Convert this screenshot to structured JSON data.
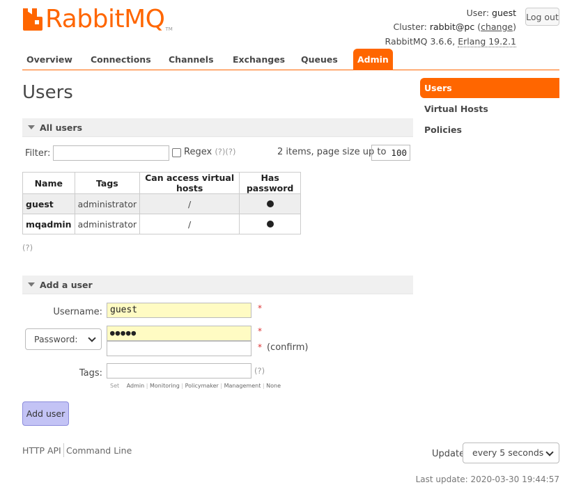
{
  "brand": {
    "logo_text": "RabbitMQ",
    "logo_tm": "TM",
    "accent": "#ff6600"
  },
  "header": {
    "user_label": "User:",
    "user_value": "guest",
    "cluster_label": "Cluster:",
    "cluster_value": "rabbit@pc",
    "change_link": "change",
    "version_text": "RabbitMQ 3.6.6,",
    "erlang_link": "Erlang 19.2.1",
    "logout_label": "Log out"
  },
  "tabs": [
    {
      "label": "Overview"
    },
    {
      "label": "Connections"
    },
    {
      "label": "Channels"
    },
    {
      "label": "Exchanges"
    },
    {
      "label": "Queues"
    },
    {
      "label": "Admin",
      "active": true
    }
  ],
  "sidebar": {
    "items": [
      {
        "label": "Users",
        "active": true
      },
      {
        "label": "Virtual Hosts"
      },
      {
        "label": "Policies"
      }
    ]
  },
  "page": {
    "title": "Users"
  },
  "all_users": {
    "section_title": "All users",
    "filter_label": "Filter:",
    "filter_value": "",
    "regex_label": "Regex",
    "regex_help": "(?)(?)",
    "pager_text": "2 items, page size up to",
    "page_size": "100",
    "columns": [
      "Name",
      "Tags",
      "Can access virtual hosts",
      "Has password"
    ],
    "rows": [
      {
        "name": "guest",
        "tags": "administrator",
        "vhosts": "/",
        "has_password": true
      },
      {
        "name": "mqadmin",
        "tags": "administrator",
        "vhosts": "/",
        "has_password": true
      }
    ],
    "help": "(?)"
  },
  "add_user": {
    "section_title": "Add a user",
    "username_label": "Username:",
    "username_value": "guest",
    "password_select": "Password:",
    "password_value": "●●●●●",
    "password_confirm_value": "",
    "confirm_label": "(confirm)",
    "required_mark": "*",
    "tags_label": "Tags:",
    "tags_value": "",
    "tags_help": "(?)",
    "tag_hints_set": "Set",
    "tag_hints": [
      "Admin",
      "Monitoring",
      "Policymaker",
      "Management",
      "None"
    ],
    "submit_label": "Add user"
  },
  "footer": {
    "http_api": "HTTP API",
    "command_line": "Command Line",
    "update_label": "Update",
    "update_value": "every 5 seconds",
    "last_update": "Last update: 2020-03-30 19:44:57"
  }
}
